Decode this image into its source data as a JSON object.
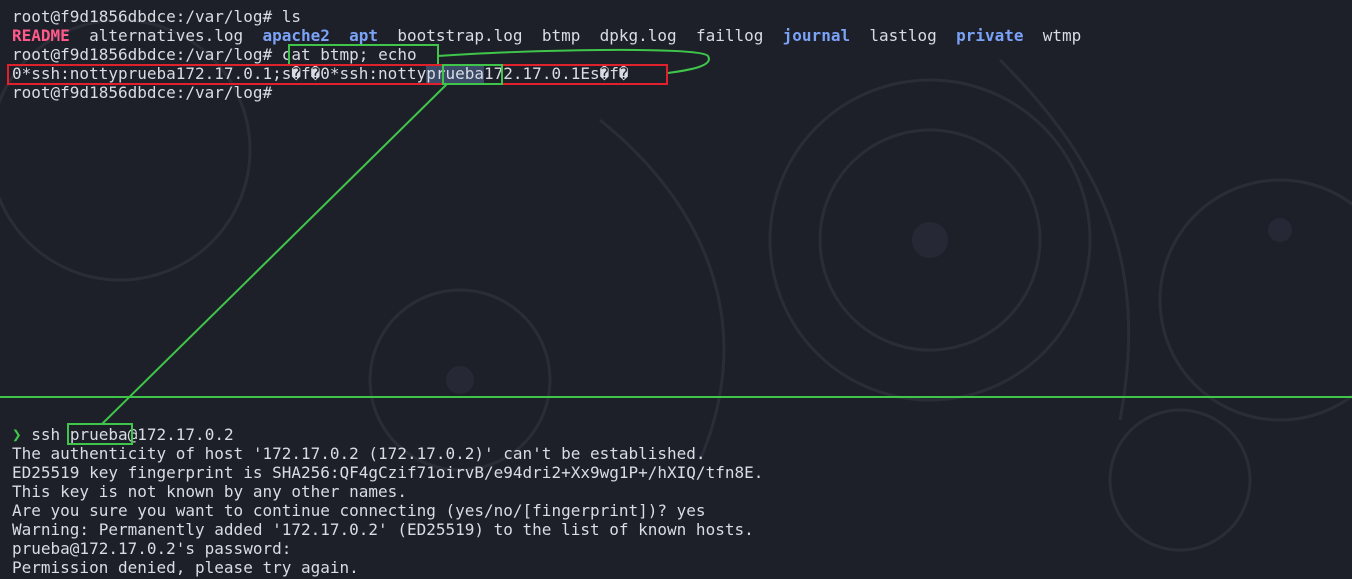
{
  "top_terminal": {
    "line1_prompt": "root@f9d1856dbdce:/var/log#",
    "line1_cmd": "ls",
    "ls_items": [
      {
        "name": "README",
        "kind": "special"
      },
      {
        "name": "alternatives.log",
        "kind": "file"
      },
      {
        "name": "apache2",
        "kind": "dir"
      },
      {
        "name": "apt",
        "kind": "dir"
      },
      {
        "name": "bootstrap.log",
        "kind": "file"
      },
      {
        "name": "btmp",
        "kind": "file"
      },
      {
        "name": "dpkg.log",
        "kind": "file"
      },
      {
        "name": "faillog",
        "kind": "file"
      },
      {
        "name": "journal",
        "kind": "dir"
      },
      {
        "name": "lastlog",
        "kind": "file"
      },
      {
        "name": "private",
        "kind": "dir"
      },
      {
        "name": "wtmp",
        "kind": "file"
      }
    ],
    "line3_prompt": "root@f9d1856dbdce:/var/log#",
    "line3_cmd": "cat btmp; echo",
    "btmp_output_before": "0*ssh:nottyprueba172.17.0.1;s�f�0*ssh:notty",
    "btmp_output_highlight": "prueba",
    "btmp_output_after": "172.17.0.1Es�f�",
    "line5_prompt": "root@f9d1856dbdce:/var/log#"
  },
  "bottom_terminal": {
    "prompt_symbol": "❯",
    "ssh_cmd": "ssh",
    "ssh_user": "prueba",
    "ssh_host": "@172.17.0.2",
    "lines": [
      "The authenticity of host '172.17.0.2 (172.17.0.2)' can't be established.",
      "ED25519 key fingerprint is SHA256:QF4gCzif71oirvB/e94dri2+Xx9wg1P+/hXIQ/tfn8E.",
      "This key is not known by any other names.",
      "Are you sure you want to continue connecting (yes/no/[fingerprint])? yes",
      "Warning: Permanently added '172.17.0.2' (ED25519) to the list of known hosts.",
      "prueba@172.17.0.2's password:",
      "Permission denied, please try again."
    ]
  },
  "colors": {
    "background": "#1e2029",
    "text": "#d9dce3",
    "directory": "#7aa2f7",
    "readme": "#ff5a8a",
    "annotation_green": "#3fc64a",
    "annotation_red": "#e0202a"
  }
}
